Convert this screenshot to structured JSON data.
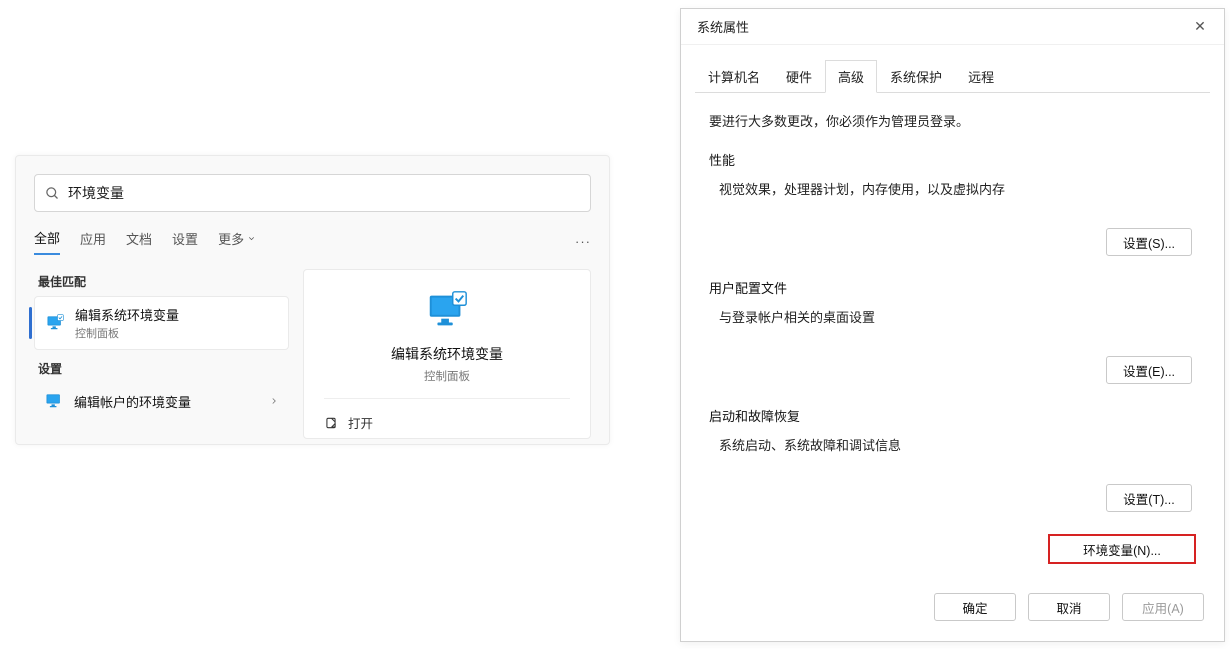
{
  "search_panel": {
    "search_value": "环境变量",
    "tabs": [
      "全部",
      "应用",
      "文档",
      "设置"
    ],
    "more_label": "更多",
    "best_match_label": "最佳匹配",
    "settings_label": "设置",
    "result1": {
      "title": "编辑系统环境变量",
      "sub": "控制面板"
    },
    "result2": {
      "title": "编辑帐户的环境变量"
    },
    "preview": {
      "title": "编辑系统环境变量",
      "sub": "控制面板",
      "open_label": "打开"
    }
  },
  "dialog": {
    "title": "系统属性",
    "tabs": {
      "computer_name": "计算机名",
      "hardware": "硬件",
      "advanced": "高级",
      "system_protection": "系统保护",
      "remote": "远程"
    },
    "admin_note": "要进行大多数更改，你必须作为管理员登录。",
    "group_perf": {
      "title": "性能",
      "desc": "视觉效果，处理器计划，内存使用，以及虚拟内存",
      "button": "设置(S)..."
    },
    "group_profile": {
      "title": "用户配置文件",
      "desc": "与登录帐户相关的桌面设置",
      "button": "设置(E)..."
    },
    "group_startup": {
      "title": "启动和故障恢复",
      "desc": "系统启动、系统故障和调试信息",
      "button": "设置(T)..."
    },
    "env_button": "环境变量(N)...",
    "footer": {
      "ok": "确定",
      "cancel": "取消",
      "apply": "应用(A)"
    }
  }
}
